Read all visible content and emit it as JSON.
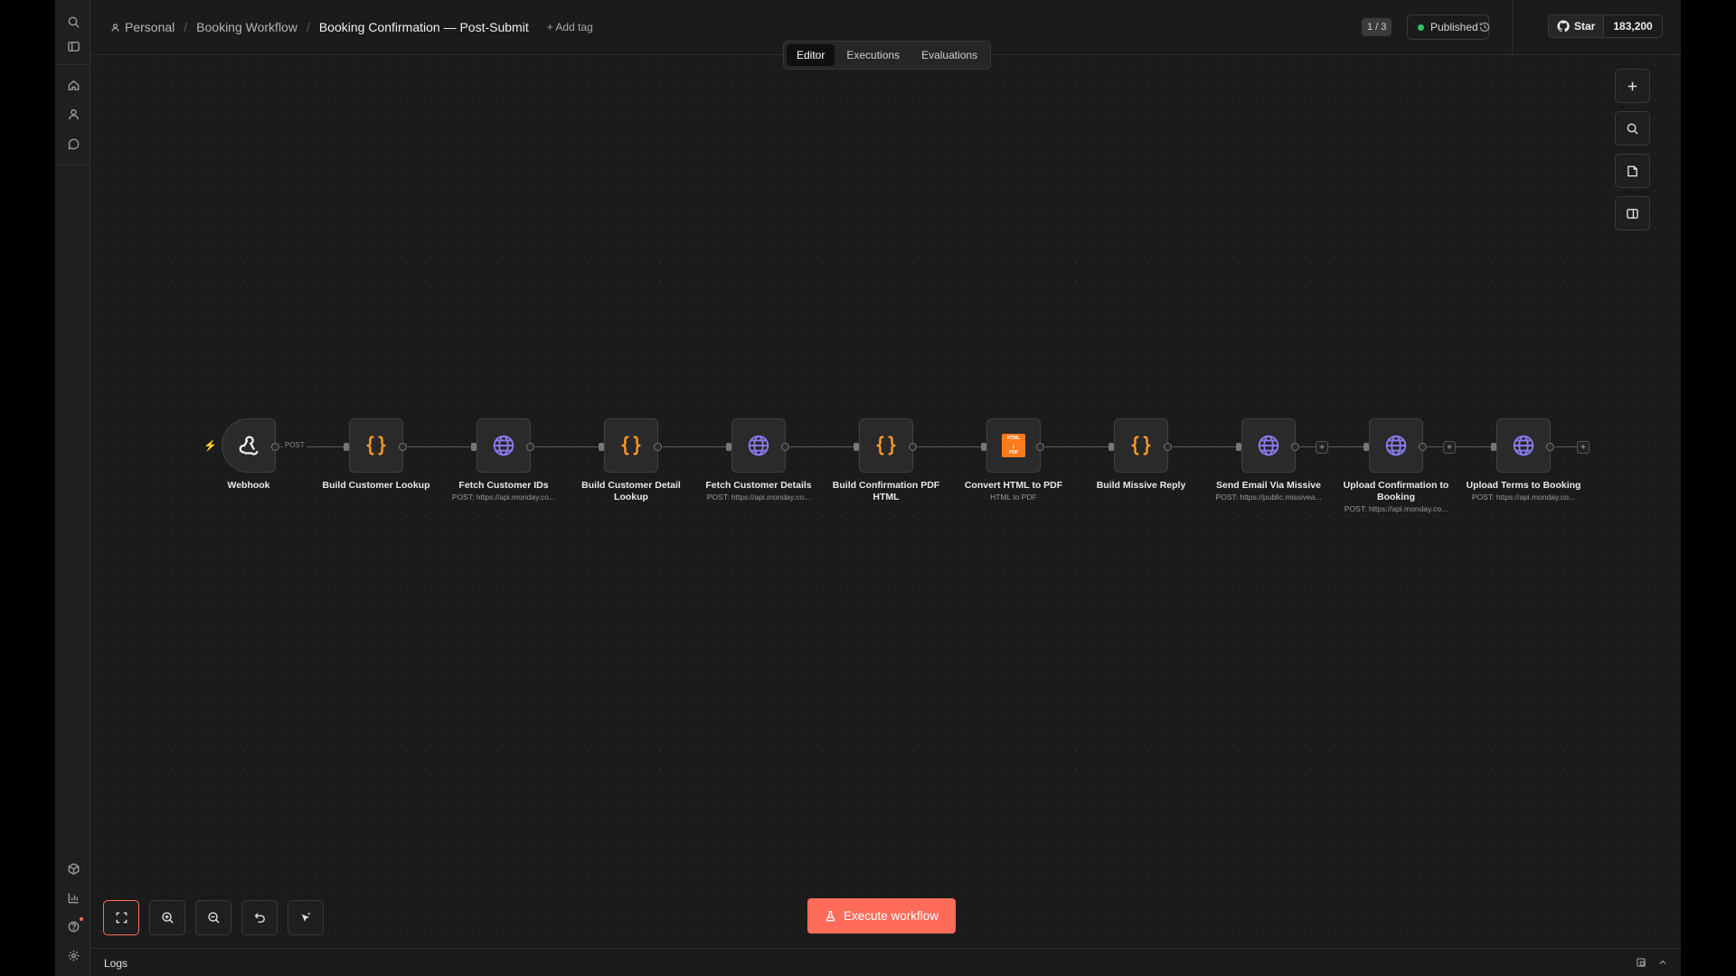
{
  "header": {
    "breadcrumb": {
      "project": "Personal",
      "folder": "Booking Workflow",
      "workflow": "Booking Confirmation — Post-Submit"
    },
    "add_tag": "+ Add tag",
    "version": "1 / 3",
    "status": "Published",
    "github_star": "Star",
    "github_count": "183,200"
  },
  "tabs": [
    {
      "label": "Editor",
      "active": true
    },
    {
      "label": "Executions",
      "active": false
    },
    {
      "label": "Evaluations",
      "active": false
    }
  ],
  "nodes": [
    {
      "name": "Webhook",
      "sub": "",
      "icon": "webhook-icon"
    },
    {
      "name": "Build Customer Lookup",
      "sub": "",
      "icon": "code-icon"
    },
    {
      "name": "Fetch Customer IDs",
      "sub": "POST: https://api.monday.co...",
      "icon": "globe-icon"
    },
    {
      "name": "Build Customer Detail Lookup",
      "sub": "",
      "icon": "code-icon"
    },
    {
      "name": "Fetch Customer Details",
      "sub": "POST: https://api.monday.co...",
      "icon": "globe-icon"
    },
    {
      "name": "Build Confirmation PDF HTML",
      "sub": "",
      "icon": "code-icon"
    },
    {
      "name": "Convert HTML to PDF",
      "sub": "HTML to PDF",
      "icon": "html-to-pdf-icon"
    },
    {
      "name": "Build Missive Reply",
      "sub": "",
      "icon": "code-icon"
    },
    {
      "name": "Send Email Via Missive",
      "sub": "POST: https://public.missivea...",
      "icon": "globe-icon"
    },
    {
      "name": "Upload Confirmation to Booking",
      "sub": "POST: https://api.monday.co...",
      "icon": "globe-icon"
    },
    {
      "name": "Upload Terms to Booking",
      "sub": "POST: https://api.monday.co...",
      "icon": "globe-icon"
    }
  ],
  "connection_label": "POST",
  "html_pdf_icon_text": {
    "top": "HTML",
    "bottom": "PDF"
  },
  "execute_label": "Execute workflow",
  "logs_label": "Logs",
  "colors": {
    "accent": "#ff6d5a",
    "code_orange": "#ff9b26",
    "globe_purple": "#8a7cf0",
    "published_green": "#2fc46a"
  }
}
